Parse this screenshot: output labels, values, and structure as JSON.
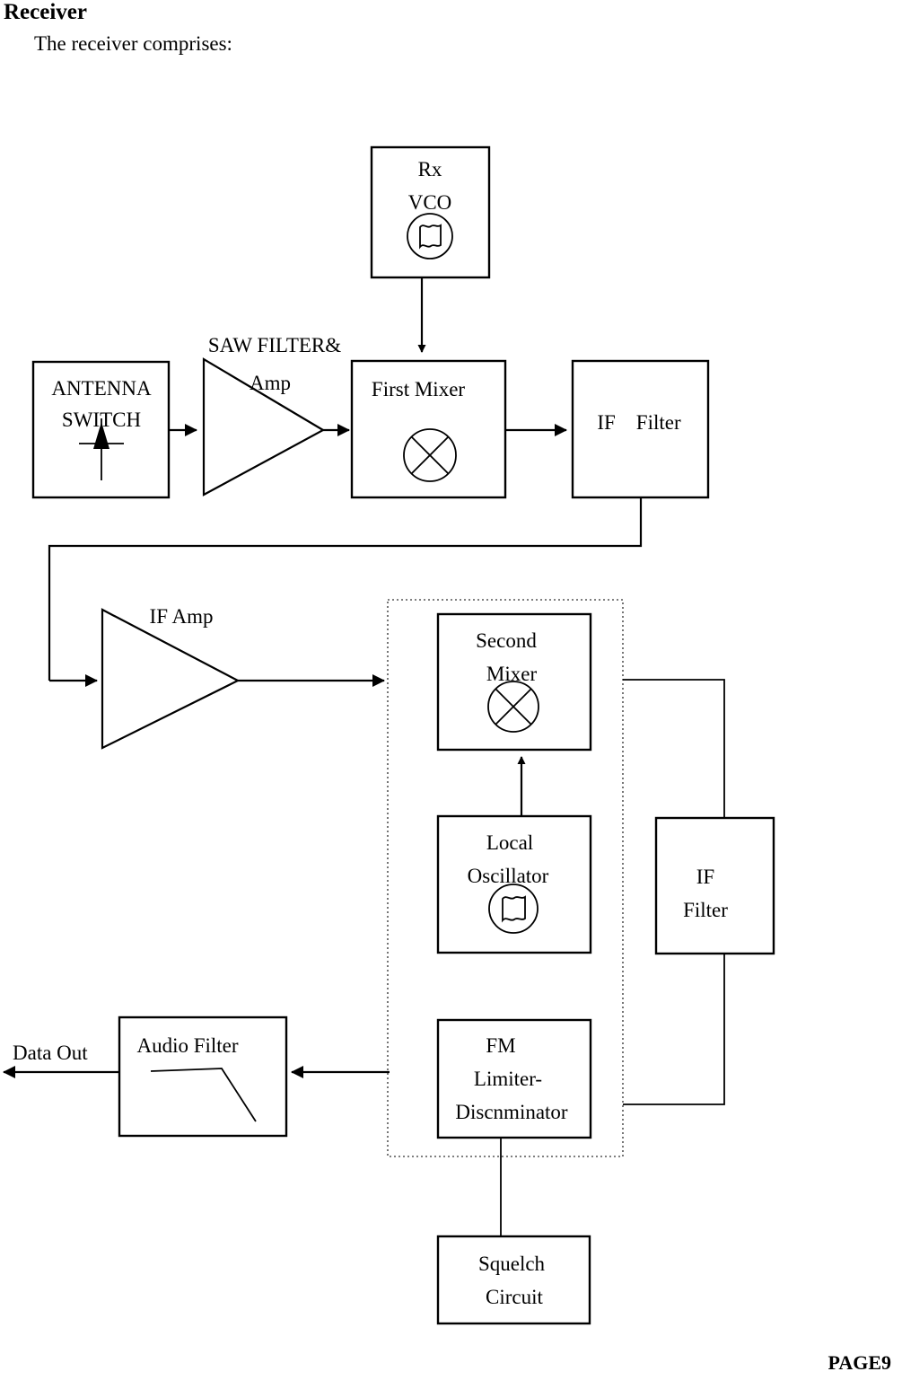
{
  "document": {
    "heading": "Receiver",
    "intro": "The receiver comprises:",
    "page_footer": "PAGE9"
  },
  "colors": {
    "ink": "#000000",
    "background": "#ffffff",
    "dotted_border": "#555555"
  },
  "blocks": {
    "rx_vco": {
      "line1": "Rx",
      "line2": "VCO",
      "symbol": "oscillator-icon"
    },
    "antenna_switch": {
      "line1": "ANTENNA",
      "line2": "SWITCH",
      "symbol": "antenna-icon"
    },
    "saw_filter_amp": {
      "line1": "SAW FILTER&",
      "line2": "Amp",
      "symbol": "amplifier-triangle-icon"
    },
    "first_mixer": {
      "line1": "First Mixer",
      "symbol": "mixer-icon"
    },
    "if_filter_top": {
      "line1": "IF    Filter"
    },
    "if_amp": {
      "line1": "IF Amp",
      "symbol": "amplifier-triangle-icon"
    },
    "second_mixer": {
      "line1": "Second",
      "line2": "Mixer",
      "symbol": "mixer-icon"
    },
    "local_oscillator": {
      "line1": "Local",
      "line2": "Oscillator",
      "symbol": "oscillator-icon"
    },
    "if_filter_right": {
      "line1": "IF",
      "line2": "Filter"
    },
    "fm_limiter": {
      "line1": "FM",
      "line2": "Limiter-",
      "line3": "Discnminator"
    },
    "audio_filter": {
      "line1": "Audio Filter",
      "symbol": "lowpass-response-icon"
    },
    "squelch_circuit": {
      "line1": "Squelch",
      "line2": "Circuit"
    }
  },
  "labels": {
    "data_out": "Data Out"
  }
}
